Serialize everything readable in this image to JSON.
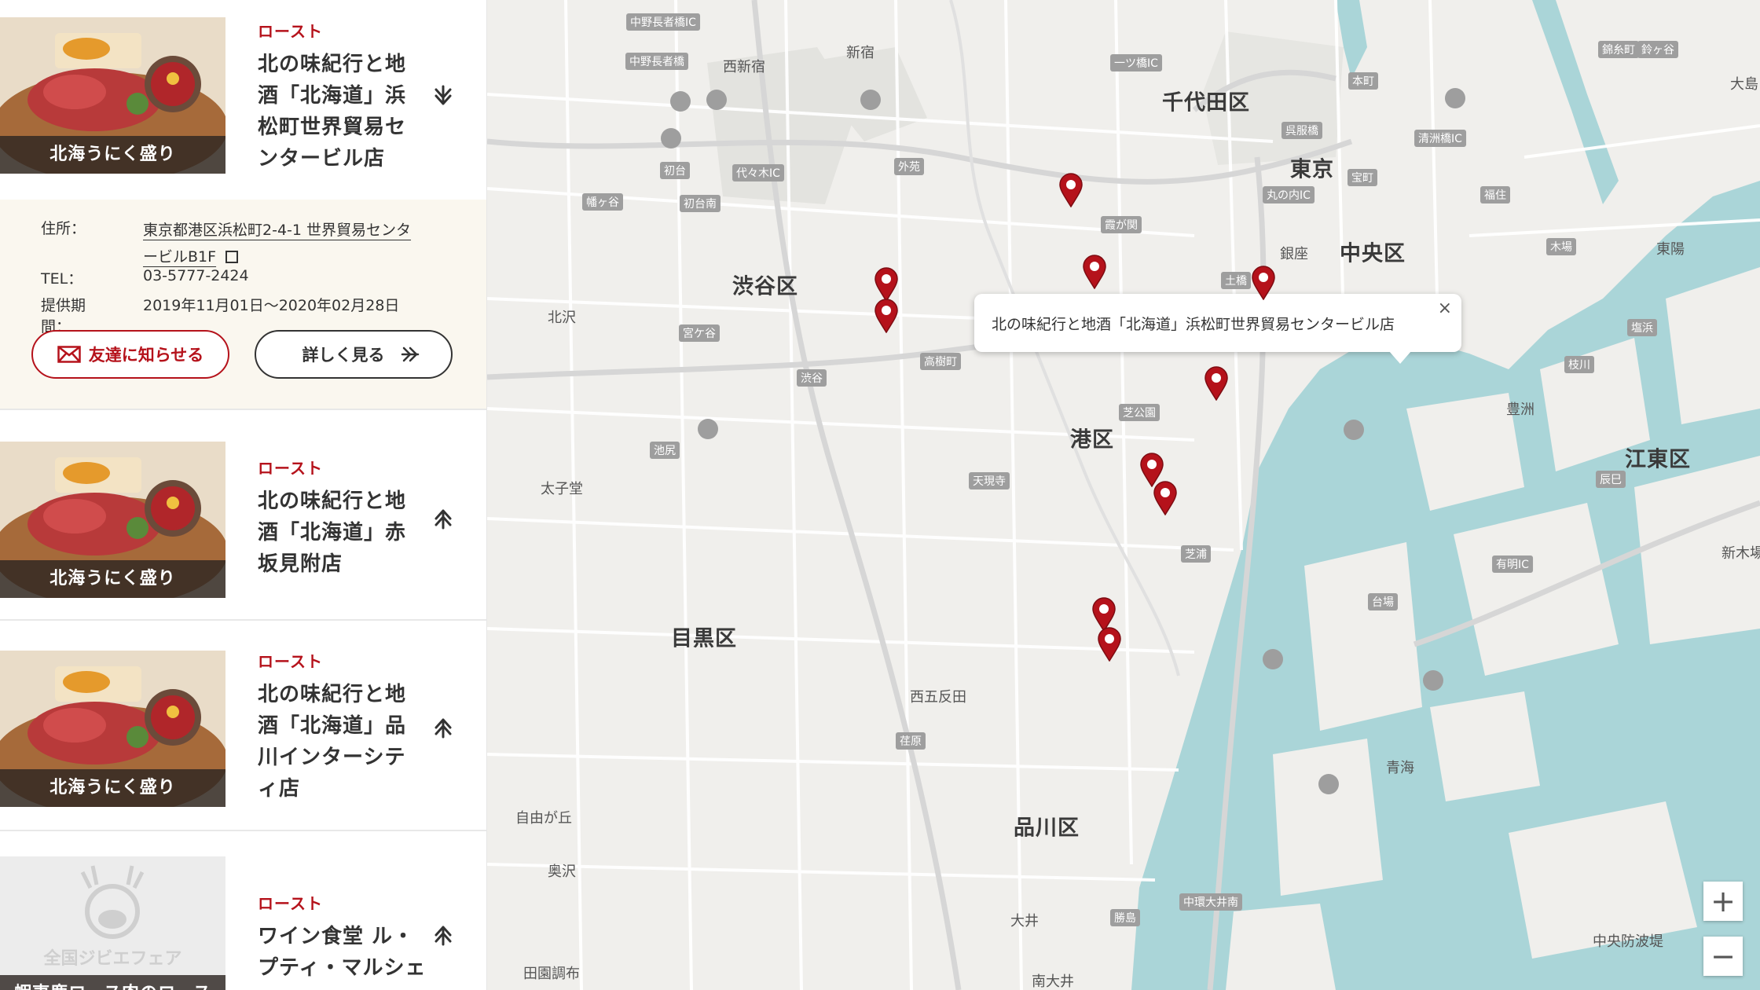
{
  "colors": {
    "accent": "#b5121b",
    "water": "#aad5d8",
    "land": "#f0efec",
    "detail_bg": "#faf7ef"
  },
  "cards": [
    {
      "image_caption": "北海うにく盛り",
      "category": "ロースト",
      "name_lines": [
        "北の味紀行と地",
        "酒「北海道」浜",
        "松町世界貿易セ",
        "ンタービル店"
      ],
      "arrow": "down"
    },
    {
      "image_caption": "北海うにく盛り",
      "category": "ロースト",
      "name_lines": [
        "北の味紀行と地",
        "酒「北海道」赤",
        "坂見附店"
      ],
      "arrow": "up"
    },
    {
      "image_caption": "北海うにく盛り",
      "category": "ロースト",
      "name_lines": [
        "北の味紀行と地",
        "酒「北海道」品",
        "川インターシテ",
        "ィ店"
      ],
      "arrow": "up"
    },
    {
      "image_caption": "蝦夷鹿ロース肉のロース",
      "category": "ロースト",
      "name_lines": [
        "ワイン食堂 ル・",
        "プティ・マルシェ"
      ],
      "arrow": "up",
      "placeholder_text": "全国ジビエフェア"
    }
  ],
  "detail": {
    "address_label": "住所：",
    "address_line1": "東京都港区浜松町2-4-1 世界貿易センタ",
    "address_line2": "ービルB1F",
    "tel_label": "TEL：",
    "tel": "03-5777-2424",
    "period_label": "提供期間：",
    "period": "2019年11月01日〜2020年02月28日",
    "share_label": "友達に知らせる",
    "more_label": "詳しく見る"
  },
  "map": {
    "infowindow_text": "北の味紀行と地酒「北海道」浜松町世界貿易センタービル店",
    "infowindow_close": "×",
    "zoom_in": "+",
    "zoom_out": "−",
    "wards": [
      "千代田区",
      "東京",
      "中央区",
      "渋谷区",
      "港区",
      "江東区",
      "目黒区",
      "品川区"
    ],
    "places": [
      "新宿",
      "西新宿",
      "北沢",
      "太子堂",
      "銀座",
      "東陽",
      "豊洲",
      "青海",
      "西五反田",
      "自由が丘",
      "奥沢",
      "大井",
      "南大井",
      "田園調布",
      "中央防波堤",
      "大島",
      "新木場"
    ],
    "road_labels": [
      "中野長者橋IC",
      "中野長者橋",
      "代々木IC",
      "初台",
      "幡ヶ谷",
      "初台南",
      "外苑",
      "一ツ橋IC",
      "本町",
      "呉服橋",
      "宝町",
      "丸の内IC",
      "霞が関",
      "土橋",
      "芝公園",
      "芝浦",
      "清洲橋IC",
      "福住",
      "木場",
      "枝川",
      "塩浜",
      "辰巳",
      "有明IC",
      "台場",
      "宮ケ谷",
      "渋谷",
      "高樹町",
      "池尻",
      "天現寺",
      "荏原",
      "勝島",
      "中環大井南",
      "鈴ヶ谷",
      "錦糸町"
    ]
  }
}
